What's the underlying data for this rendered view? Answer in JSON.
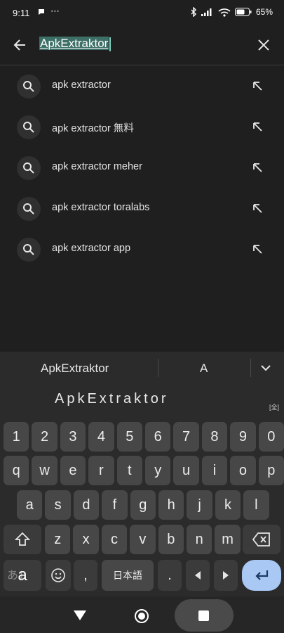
{
  "status_bar": {
    "time": "9:11",
    "battery": "65%"
  },
  "search": {
    "query": "ApkExtraktor"
  },
  "suggestions": [
    {
      "text": "apk extractor"
    },
    {
      "text": "apk extractor 無料"
    },
    {
      "text": "apk extractor meher"
    },
    {
      "text": "apk extractor toralabs"
    },
    {
      "text": "apk extractor app"
    }
  ],
  "keyboard": {
    "candidates": [
      "ApkExtraktor",
      "A"
    ],
    "composition": "ApkExtraktor",
    "fullwidth_badge": "[全]",
    "rows": [
      [
        "1",
        "2",
        "3",
        "4",
        "5",
        "6",
        "7",
        "8",
        "9",
        "0"
      ],
      [
        "q",
        "w",
        "e",
        "r",
        "t",
        "y",
        "u",
        "i",
        "o",
        "p"
      ],
      [
        "a",
        "s",
        "d",
        "f",
        "g",
        "h",
        "j",
        "k",
        "l"
      ],
      [
        "z",
        "x",
        "c",
        "v",
        "b",
        "n",
        "m"
      ]
    ],
    "mode_key": "a",
    "mode_key_bg": "あ1",
    "comma": ",",
    "lang_key": "日本語",
    "period": "."
  },
  "colors": {
    "accent": "#a9c8f4",
    "selection": "#3d6f67"
  }
}
